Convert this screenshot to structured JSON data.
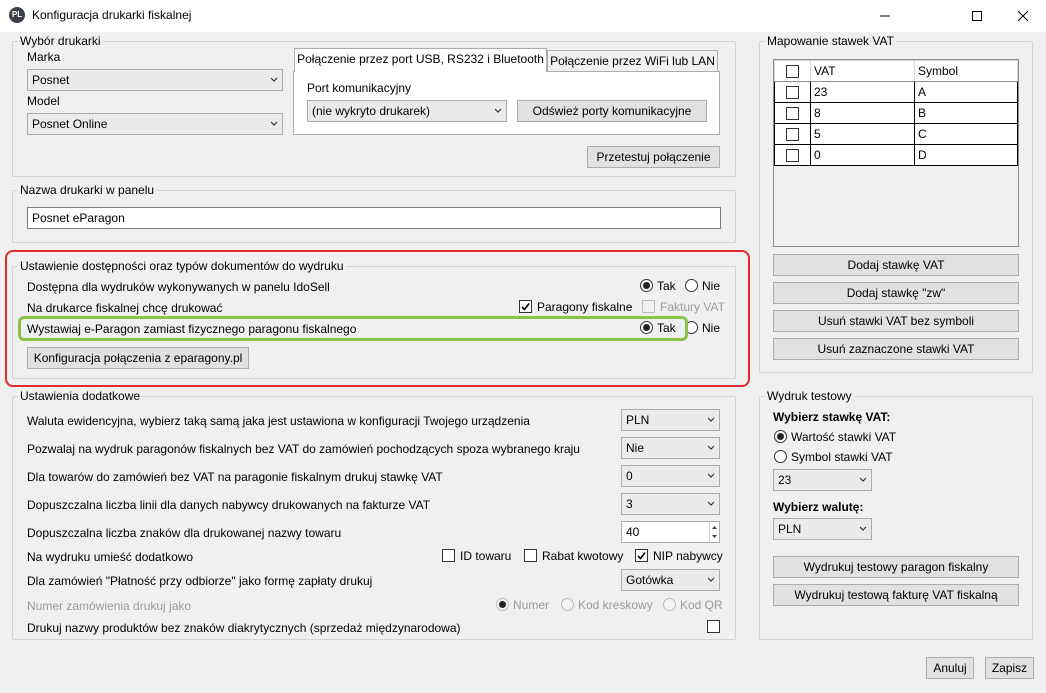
{
  "window": {
    "title": "Konfiguracja drukarki fiskalnej",
    "icon_text": "PL",
    "icons": [
      "minimize-icon",
      "maximize-icon",
      "close-icon"
    ]
  },
  "printer_select": {
    "legend": "Wybór drukarki",
    "brand_label": "Marka",
    "brand_value": "Posnet",
    "model_label": "Model",
    "model_value": "Posnet Online",
    "tabs": [
      "Połączenie przez port USB, RS232 i Bluetooth",
      "Połączenie przez WiFi lub LAN"
    ],
    "port_label": "Port komunikacyjny",
    "port_value": "(nie wykryto drukarek)",
    "refresh_button": "Odśwież porty komunikacyjne",
    "test_button": "Przetestuj połączenie"
  },
  "printer_name": {
    "legend": "Nazwa drukarki w panelu",
    "value": "Posnet eParagon"
  },
  "availability": {
    "legend": "Ustawienie dostępności oraz typów dokumentów do wydruku",
    "row1_label": "Dostępna dla wydruków wykonywanych w panelu IdoSell",
    "row2_label": "Na drukarce fiskalnej chcę drukować",
    "row3_label": "Wystawiaj e-Paragon zamiast fizycznego paragonu fiskalnego",
    "yes": "Tak",
    "no": "Nie",
    "receipts": "Paragony fiskalne",
    "invoices": "Faktury VAT",
    "config_button": "Konfiguracja połączenia z eparagony.pl"
  },
  "extra": {
    "legend": "Ustawienia dodatkowe",
    "currency_label": "Waluta ewidencyjna, wybierz taką samą jaka jest ustawiona w konfiguracji Twojego urządzenia",
    "currency_value": "PLN",
    "novat_label": "Pozwalaj na wydruk paragonów fiskalnych bez VAT do zamówień pochodzących spoza wybranego kraju",
    "novat_value": "Nie",
    "vatrate_label": "Dla towarów do zamówień bez VAT na paragonie fiskalnym drukuj stawkę VAT",
    "vatrate_value": "0",
    "lines_label": "Dopuszczalna liczba linii dla danych nabywcy drukowanych na fakturze VAT",
    "lines_value": "3",
    "chars_label": "Dopuszczalna liczba znaków dla drukowanej nazwy towaru",
    "chars_value": "40",
    "add_label": "Na wydruku umieść dodatkowo",
    "add_id": "ID towaru",
    "add_discount": "Rabat kwotowy",
    "add_nip": "NIP nabywcy",
    "payment_label": "Dla zamówień \"Płatność przy odbiorze\" jako formę zapłaty drukuj",
    "payment_value": "Gotówka",
    "ordernum_label": "Numer zamówienia drukuj jako",
    "opt_number": "Numer",
    "opt_barcode": "Kod kreskowy",
    "opt_qr": "Kod QR",
    "diacritics_label": "Drukuj nazwy produktów bez znaków diakrytycznych (sprzedaż międzynarodowa)"
  },
  "vat_mapping": {
    "legend": "Mapowanie stawek VAT",
    "col_vat": "VAT",
    "col_symbol": "Symbol",
    "rows": [
      {
        "vat": "23",
        "symbol": "A"
      },
      {
        "vat": "8",
        "symbol": "B"
      },
      {
        "vat": "5",
        "symbol": "C"
      },
      {
        "vat": "0",
        "symbol": "D"
      }
    ],
    "add_button": "Dodaj stawkę VAT",
    "add_zw_button": "Dodaj stawkę \"zw\"",
    "remove_nosym_button": "Usuń stawki VAT bez symboli",
    "remove_sel_button": "Usuń zaznaczone stawki VAT"
  },
  "test_print": {
    "legend": "Wydruk testowy",
    "rate_heading": "Wybierz stawkę VAT:",
    "opt_value": "Wartość stawki VAT",
    "opt_symbol": "Symbol stawki VAT",
    "rate_value": "23",
    "currency_heading": "Wybierz walutę:",
    "currency_value": "PLN",
    "receipt_button": "Wydrukuj testowy paragon fiskalny",
    "invoice_button": "Wydrukuj testową fakturę VAT fiskalną"
  },
  "footer": {
    "cancel": "Anuluj",
    "save": "Zapisz"
  },
  "colors": {
    "highlight_red": "#e22b2b",
    "highlight_green": "#8bc34a"
  }
}
